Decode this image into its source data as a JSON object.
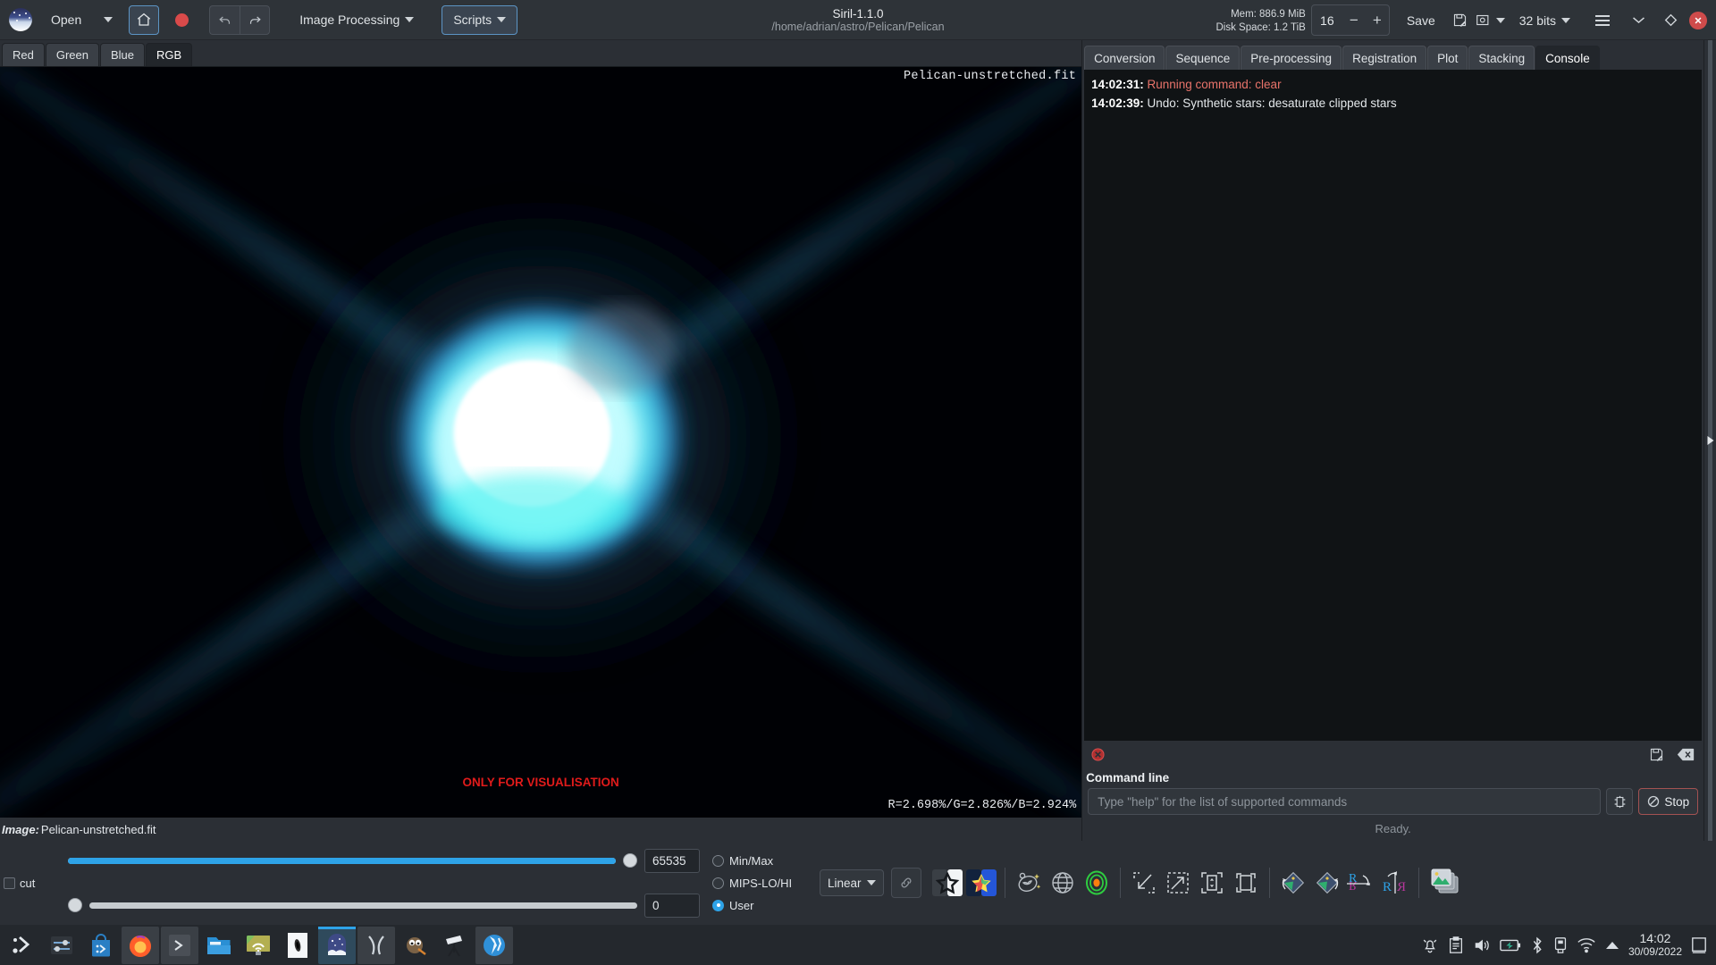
{
  "window": {
    "title": "Siril-1.1.0",
    "subtitle": "/home/adrian/astro/Pelican/Pelican"
  },
  "header": {
    "open_label": "Open",
    "image_processing_label": "Image Processing",
    "scripts_label": "Scripts",
    "home_icon": "home-icon",
    "record_icon": "record-icon",
    "undo_icon": "undo-icon",
    "redo_icon": "redo-icon",
    "mem_label": "Mem: 886.9 MiB",
    "disk_label": "Disk Space: 1.2 TiB",
    "zoom_value": "16",
    "zoom_minus": "−",
    "zoom_plus": "+",
    "save_label": "Save",
    "save_as_icon": "save-as-icon",
    "snapshot_icon": "snapshot-icon",
    "bitdepth_label": "32 bits",
    "menu_icon": "hamburger-menu-icon",
    "chevron_icon": "chevron-down-icon",
    "diamond_icon": "diamond-icon",
    "close_icon": "close-icon"
  },
  "channel_tabs": [
    {
      "label": "Red",
      "active": false
    },
    {
      "label": "Green",
      "active": false
    },
    {
      "label": "Blue",
      "active": false
    },
    {
      "label": "RGB",
      "active": true
    }
  ],
  "canvas": {
    "filename": "Pelican-unstretched.fit",
    "visualisation_note": "ONLY FOR VISUALISATION",
    "rgb_readout": "R=2.698%/G=2.826%/B=2.924%"
  },
  "image_footer": {
    "label": "Image:",
    "value": "Pelican-unstretched.fit"
  },
  "right_panel": {
    "tabs": [
      {
        "label": "Conversion",
        "active": false
      },
      {
        "label": "Sequence",
        "active": false
      },
      {
        "label": "Pre-processing",
        "active": false
      },
      {
        "label": "Registration",
        "active": false
      },
      {
        "label": "Plot",
        "active": false
      },
      {
        "label": "Stacking",
        "active": false
      },
      {
        "label": "Console",
        "active": true
      }
    ],
    "console_lines": [
      {
        "time": "14:02:31:",
        "text": "Running command: clear",
        "color": "red"
      },
      {
        "time": "14:02:39:",
        "text": "Undo: Synthetic stars: desaturate clipped stars",
        "color": "normal"
      }
    ],
    "console_toolbar": {
      "error_icon": "error-circle-icon",
      "export_log_icon": "export-log-icon",
      "clear_log_icon": "clear-log-icon"
    },
    "command_line": {
      "label": "Command line",
      "placeholder": "Type \"help\" for the list of supported commands",
      "value": "",
      "settings_icon": "command-settings-icon",
      "stop_label": "Stop",
      "stop_icon": "stop-icon",
      "status": "Ready."
    }
  },
  "bottom_bar": {
    "cut_label": "cut",
    "hi_value": "65535",
    "lo_value": "0",
    "hi_fill_percent": 100,
    "lo_fill_percent": 0,
    "modes": [
      {
        "label": "Min/Max",
        "selected": false
      },
      {
        "label": "MIPS-LO/HI",
        "selected": false
      },
      {
        "label": "User",
        "selected": true
      }
    ],
    "stretch_mode": "Linear",
    "chain_icon": "chain-link-icon",
    "tools": [
      "bw-star-icon",
      "color-star-icon",
      "galaxy-annotate-icon",
      "grid-globe-icon",
      "target-rings-icon",
      "zoom-out-icon",
      "zoom-in-icon",
      "zoom-fit-icon",
      "zoom-100-icon",
      "rotate-ccw-icon",
      "rotate-cw-icon",
      "mirror-horizontal-icon",
      "mirror-vertical-icon",
      "image-stack-icon"
    ]
  },
  "taskbar": {
    "launchers": [
      "menu-icon",
      "settings-sliders-icon",
      "software-store-icon",
      "firefox-icon",
      "terminal-icon",
      "files-icon",
      "remote-desktop-icon",
      "galaxy-app-icon",
      "siril-icon",
      "pixinsight-icon",
      "gimp-icon",
      "telescope-icon",
      "kstars-icon"
    ],
    "tray": [
      "notifications-icon",
      "clipboard-icon",
      "volume-icon",
      "battery-icon",
      "bluetooth-icon",
      "usb-icon",
      "wifi-icon",
      "show-hidden-icon"
    ],
    "time": "14:02",
    "date": "30/09/2022",
    "show_desktop_icon": "show-desktop-icon"
  },
  "colors": {
    "accent": "#2ea3e8",
    "warning_red": "#e01b1b",
    "log_red": "#e8736a",
    "panel_bg": "#2b2f35",
    "console_bg": "#101315"
  }
}
